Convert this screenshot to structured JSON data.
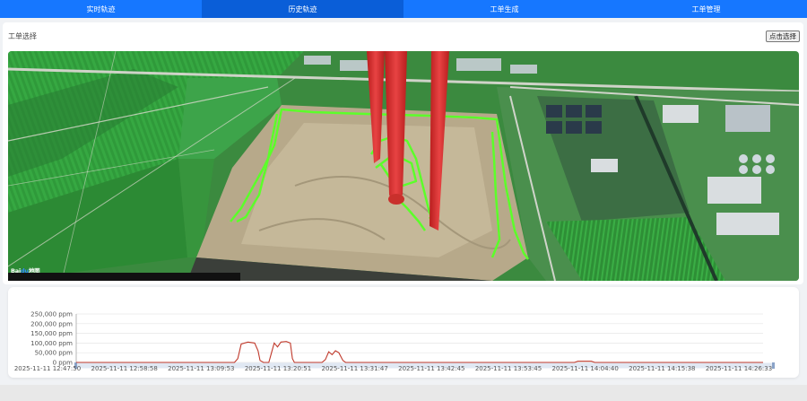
{
  "nav": {
    "tabs": [
      {
        "label": "实时轨迹",
        "active": false
      },
      {
        "label": "历史轨迹",
        "active": true
      },
      {
        "label": "工单生成",
        "active": false
      },
      {
        "label": "工单管理",
        "active": false
      }
    ],
    "color": "#1677ff",
    "active_color": "#0a5ed8"
  },
  "panel": {
    "title": "工单选择",
    "select_button": "点击选择"
  },
  "map": {
    "logo": "Bai",
    "logo_paw": "du",
    "logo_suffix": "地图",
    "track_color": "#5cff2a",
    "marker_color": "#e02828"
  },
  "chart_data": {
    "type": "line",
    "y_ticks": [
      "250,000 ppm",
      "200,000 ppm",
      "150,000 ppm",
      "100,000 ppm",
      "50,000 ppm",
      "0 ppm"
    ],
    "x_ticks": [
      "2025-11-11 12:47:50",
      "2025-11-11 12:58:58",
      "2025-11-11 13:09:53",
      "2025-11-11 13:20:51",
      "2025-11-11 13:31:47",
      "2025-11-11 13:42:45",
      "2025-11-11 13:53:45",
      "2025-11-11 14:04:40",
      "2025-11-11 14:15:38",
      "2025-11-11 14:26:33"
    ],
    "ylim": [
      0,
      250000
    ],
    "xlim_minutes": [
      0,
      102
    ],
    "grid": true,
    "series": [
      {
        "color": "#c0392b",
        "points": [
          [
            0,
            0
          ],
          [
            23.5,
            0
          ],
          [
            24.0,
            20000
          ],
          [
            24.5,
            95000
          ],
          [
            25.5,
            105000
          ],
          [
            26.5,
            100000
          ],
          [
            27.0,
            60000
          ],
          [
            27.3,
            10000
          ],
          [
            27.8,
            0
          ],
          [
            28.6,
            0
          ],
          [
            29.0,
            50000
          ],
          [
            29.4,
            100000
          ],
          [
            29.9,
            80000
          ],
          [
            30.4,
            105000
          ],
          [
            31.2,
            108000
          ],
          [
            31.8,
            100000
          ],
          [
            32.1,
            20000
          ],
          [
            32.4,
            0
          ],
          [
            36.5,
            0
          ],
          [
            37.0,
            15000
          ],
          [
            37.5,
            55000
          ],
          [
            38.0,
            40000
          ],
          [
            38.5,
            60000
          ],
          [
            39.0,
            50000
          ],
          [
            39.6,
            10000
          ],
          [
            40.0,
            0
          ],
          [
            74.0,
            0
          ],
          [
            74.5,
            6000
          ],
          [
            76.5,
            6000
          ],
          [
            77.0,
            0
          ],
          [
            102,
            0
          ]
        ]
      }
    ]
  }
}
